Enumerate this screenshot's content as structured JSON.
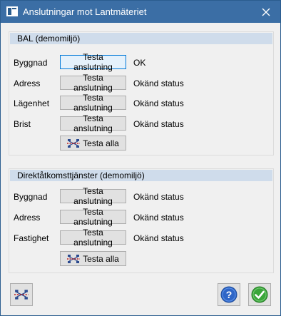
{
  "window": {
    "title": "Anslutningar mot Lantmäteriet",
    "icons": {
      "app": "window-app-icon",
      "close": "close-icon"
    }
  },
  "groups": [
    {
      "header": "BAL (demomiljö)",
      "rows": [
        {
          "label": "Byggnad",
          "button": "Testa anslutning",
          "status": "OK",
          "focused": true
        },
        {
          "label": "Adress",
          "button": "Testa anslutning",
          "status": "Okänd status"
        },
        {
          "label": "Lägenhet",
          "button": "Testa anslutning",
          "status": "Okänd status"
        },
        {
          "label": "Brist",
          "button": "Testa anslutning",
          "status": "Okänd status"
        }
      ],
      "test_all": "Testa alla"
    },
    {
      "header": "Direktåtkomsttjänster (demomiljö)",
      "rows": [
        {
          "label": "Byggnad",
          "button": "Testa anslutning",
          "status": "Okänd status"
        },
        {
          "label": "Adress",
          "button": "Testa anslutning",
          "status": "Okänd status"
        },
        {
          "label": "Fastighet",
          "button": "Testa anslutning",
          "status": "Okänd status"
        }
      ],
      "test_all": "Testa alla"
    }
  ],
  "footer": {
    "icons": [
      "network-test-icon",
      "help-icon",
      "ok-check-icon"
    ]
  },
  "colors": {
    "titlebar": "#3b6ea5",
    "group_header": "#cfdceb",
    "focus_border": "#0078d7"
  }
}
